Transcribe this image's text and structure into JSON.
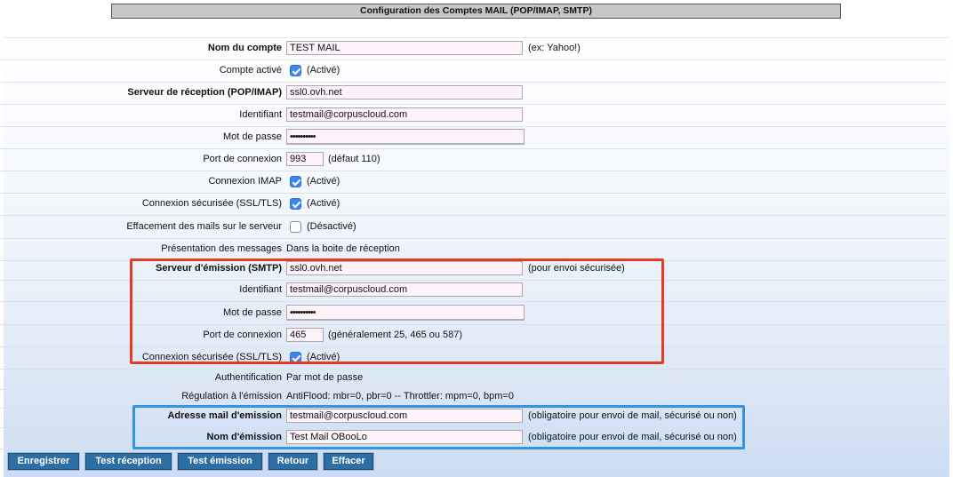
{
  "page_title": "Configuration des Comptes MAIL (POP/IMAP, SMTP)",
  "account": {
    "name_label": "Nom du compte",
    "name_value": "TEST MAIL",
    "name_hint": "(ex: Yahoo!)",
    "active_label": "Compte activé",
    "active_checked": true,
    "active_text": "(Activé)"
  },
  "incoming": {
    "server_label": "Serveur de réception (POP/IMAP)",
    "server_value": "ssl0.ovh.net",
    "login_label": "Identifiant",
    "login_value": "testmail@corpuscloud.com",
    "password_label": "Mot de passe",
    "password_value": "••••••••••",
    "port_label": "Port de connexion",
    "port_value": "993",
    "port_hint": "(défaut 110)",
    "imap_label": "Connexion IMAP",
    "imap_checked": true,
    "imap_text": "(Activé)",
    "ssl_label": "Connexion sécurisée (SSL/TLS)",
    "ssl_checked": true,
    "ssl_text": "(Activé)",
    "delete_label": "Effacement des mails sur le serveur",
    "delete_checked": false,
    "delete_text": "(Désactivé)",
    "presentation_label": "Présentation des messages",
    "presentation_value": "Dans la boite de réception"
  },
  "outgoing": {
    "server_label": "Serveur d'émission (SMTP)",
    "server_value": "ssl0.ovh.net",
    "server_hint": "(pour envoi sécurisée)",
    "login_label": "Identifiant",
    "login_value": "testmail@corpuscloud.com",
    "password_label": "Mot de passe",
    "password_value": "••••••••••",
    "port_label": "Port de connexion",
    "port_value": "465",
    "port_hint": "(généralement 25, 465 ou 587)",
    "ssl_label": "Connexion sécurisée (SSL/TLS)",
    "ssl_checked": true,
    "ssl_text": "(Activé)",
    "auth_label": "Authentification",
    "auth_value": "Par mot de passe",
    "regulation_label": "Régulation à l'émission",
    "regulation_value": "AntiFlood: mbr=0, pbr=0 -- Throttler: mpm=0, bpm=0"
  },
  "sender": {
    "address_label": "Adresse mail d'emission",
    "address_value": "testmail@corpuscloud.com",
    "address_hint": "(obligatoire pour envoi de mail, sécurisé ou non)",
    "name_label": "Nom d'émission",
    "name_value": "Test Mail OBooLo",
    "name_hint": "(obligatoire pour envoi de mail, sécurisé ou non)"
  },
  "buttons": {
    "save": "Enregistrer",
    "test_receive": "Test réception",
    "test_send": "Test émission",
    "back": "Retour",
    "delete": "Effacer"
  },
  "colors": {
    "highlight_red": "#e63a23",
    "highlight_blue": "#3393e4",
    "button_bg": "#2d6ea4",
    "checkbox_on": "#3d86f2"
  }
}
